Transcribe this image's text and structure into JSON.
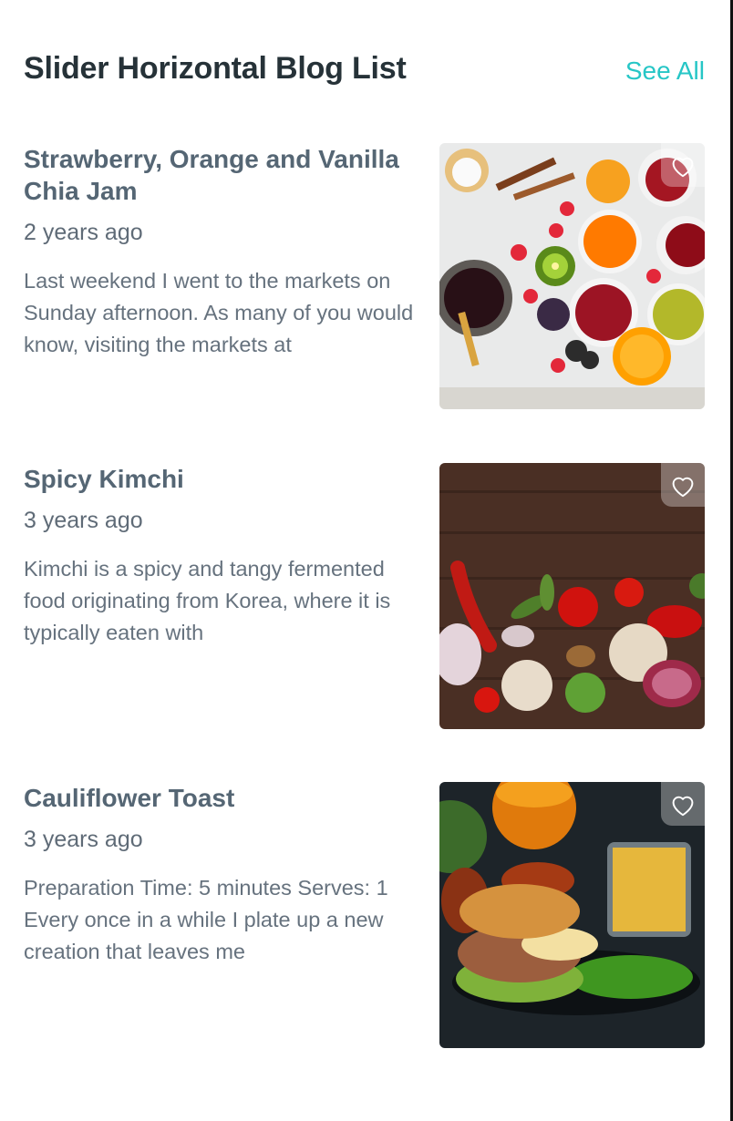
{
  "header": {
    "title": "Slider Horizontal Blog List",
    "see_all_label": "See All"
  },
  "colors": {
    "accent": "#26c6c6",
    "title": "#263238",
    "post_title": "#556674",
    "text": "#66727e"
  },
  "posts": [
    {
      "title": "Strawberry, Orange and Vanilla Chia Jam",
      "time": "2 years ago",
      "excerpt": "Last weekend I went to the markets on Sunday afternoon. As many of you would know, visiting the markets at",
      "image_icon": "jam-photo",
      "favorite_icon": "heart-outline-icon"
    },
    {
      "title": "Spicy Kimchi",
      "time": "3 years ago",
      "excerpt": "Kimchi is a spicy and tangy fermented food originating from Korea, where it is typically eaten with",
      "image_icon": "vegetables-photo",
      "favorite_icon": "heart-outline-icon"
    },
    {
      "title": "Cauliflower Toast",
      "time": "3 years ago",
      "excerpt": "Preparation Time: 5 minutes Serves: 1 Every once in a while I plate up a new creation that leaves me",
      "image_icon": "burger-photo",
      "favorite_icon": "heart-outline-icon"
    }
  ]
}
